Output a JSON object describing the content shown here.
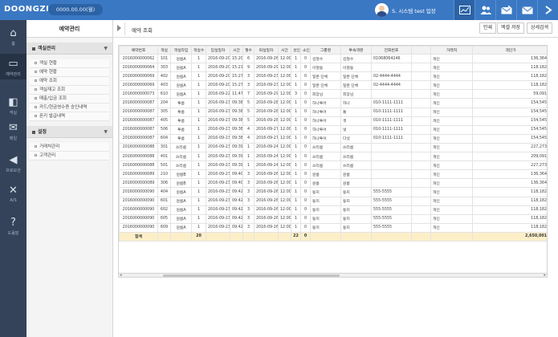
{
  "topbar": {
    "logo": "DOONGZI",
    "balance": "0000.00.00(월)",
    "user_name": "S. 시스템 test 입장",
    "icons": [
      "chart-icon",
      "users-icon",
      "envelope-tools-icon",
      "mail-icon",
      "forward-icon"
    ],
    "accent": "#3a78c3"
  },
  "leftnav": {
    "items": [
      {
        "label": "홈",
        "icon": "home-icon"
      },
      {
        "label": "예약관리",
        "icon": "monitor-icon"
      },
      {
        "label": "객실",
        "icon": "bed-icon"
      },
      {
        "label": "메일",
        "icon": "mail-icon"
      },
      {
        "label": "프로모션",
        "icon": "speaker-icon"
      },
      {
        "label": "A/S",
        "icon": "tools-icon"
      },
      {
        "label": "도움말",
        "icon": "help-icon"
      }
    ]
  },
  "sidemenu": {
    "title": "예약관리",
    "section1": {
      "title": "객실관리",
      "items": [
        "객실 현황",
        "예약 현황",
        "예약 조회",
        "객실재고 조회",
        "매출/입금 조회",
        "카드/현금영수증 승인내역",
        "폰키 발급내역"
      ]
    },
    "section2": {
      "title": "설정",
      "items": [
        "거래처관리",
        "고객관리"
      ]
    }
  },
  "content": {
    "page_title": "예약 조회",
    "buttons": {
      "print": "인쇄",
      "excel": "엑셀 저장",
      "detail_search": "상세검색"
    }
  },
  "grid": {
    "headers": [
      "예약번호",
      "객실",
      "객실타입",
      "객실수",
      "입실일자",
      "시간",
      "월수",
      "퇴실일자",
      "시간",
      "성인",
      "소인",
      "그룹명",
      "투숙객명",
      "전화번호",
      "",
      "거래처",
      "객단가"
    ],
    "rows": [
      [
        "2016000000062",
        "101",
        "원룸A",
        "1",
        "2016-09-20",
        "15:20",
        "6",
        "2016-09-26",
        "12:00",
        "1",
        "0",
        "김철수",
        "김철수",
        "01068064246",
        "",
        "개인",
        "136,364"
      ],
      [
        "2016000000064",
        "303",
        "원룸A",
        "1",
        "2016-09-20",
        "15:21",
        "9",
        "2016-09-29",
        "12:00",
        "1",
        "0",
        "이철동",
        "이철동",
        "",
        "",
        "개인",
        "118,182"
      ],
      [
        "2016000000069",
        "402",
        "원룸A",
        "1",
        "2016-09-20",
        "15:27",
        "3",
        "2016-09-23",
        "12:00",
        "1",
        "0",
        "일본 단체",
        "일본 단체",
        "02-4444-4444",
        "",
        "개인",
        "118,182"
      ],
      [
        "2016000000069",
        "403",
        "원룸A",
        "1",
        "2016-09-20",
        "15:27",
        "3",
        "2016-09-23",
        "12:00",
        "1",
        "0",
        "일본 단체",
        "일본 단체",
        "02-4444-4444",
        "",
        "개인",
        "118,182"
      ],
      [
        "2016000000073",
        "610",
        "원룸A",
        "1",
        "2016-09-22",
        "11:47",
        "7",
        "2016-09-29",
        "12:00",
        "3",
        "0",
        "회장님",
        "회장님",
        "",
        "",
        "개인",
        "59,091"
      ],
      [
        "2016000000087",
        "204",
        "투룸",
        "1",
        "2016-09-23",
        "09:38",
        "5",
        "2016-09-28",
        "12:00",
        "1",
        "0",
        "하나투어",
        "하나",
        "010-1111-1111",
        "",
        "개인",
        "154,545"
      ],
      [
        "2016000000087",
        "305",
        "투룸",
        "1",
        "2016-09-23",
        "09:38",
        "5",
        "2016-09-28",
        "12:00",
        "1",
        "0",
        "하나투어",
        "둘",
        "010-1111-1111",
        "",
        "개인",
        "154,545"
      ],
      [
        "2016000000087",
        "405",
        "투룸",
        "1",
        "2016-09-23",
        "09:38",
        "5",
        "2016-09-28",
        "12:00",
        "1",
        "0",
        "하나투어",
        "셋",
        "010-1111-1111",
        "",
        "개인",
        "154,545"
      ],
      [
        "2016000000087",
        "506",
        "투룸",
        "1",
        "2016-09-23",
        "09:38",
        "4",
        "2016-09-27",
        "12:00",
        "1",
        "0",
        "하나투어",
        "넷",
        "010-1111-1111",
        "",
        "개인",
        "154,545"
      ],
      [
        "2016000000087",
        "604",
        "투룸",
        "1",
        "2016-09-23",
        "09:38",
        "4",
        "2016-09-27",
        "12:00",
        "1",
        "0",
        "하나투어",
        "다섯",
        "010-1111-1111",
        "",
        "개인",
        "154,545"
      ],
      [
        "2016000000088",
        "301",
        "쓰리룸",
        "1",
        "2016-09-23",
        "09:39",
        "1",
        "2016-09-24",
        "12:00",
        "1",
        "0",
        "쓰리룸",
        "쓰리룸",
        "",
        "",
        "개인",
        "227,273"
      ],
      [
        "2016000000088",
        "401",
        "쓰리룸",
        "1",
        "2016-09-23",
        "09:39",
        "1",
        "2016-09-24",
        "12:00",
        "1",
        "0",
        "쓰리룸",
        "쓰리룸",
        "",
        "",
        "개인",
        "209,091"
      ],
      [
        "2016000000088",
        "501",
        "쓰리룸",
        "1",
        "2016-09-23",
        "09:39",
        "1",
        "2016-09-24",
        "12:00",
        "1",
        "0",
        "쓰리룸",
        "쓰리룸",
        "",
        "",
        "개인",
        "227,273"
      ],
      [
        "2016000000089",
        "210",
        "원룸B",
        "1",
        "2016-09-23",
        "09:40",
        "3",
        "2016-09-26",
        "12:00",
        "1",
        "0",
        "원룸",
        "원룸",
        "",
        "",
        "개인",
        "136,364"
      ],
      [
        "2016000000089",
        "306",
        "원룸B",
        "1",
        "2016-09-23",
        "09:40",
        "3",
        "2016-09-26",
        "12:00",
        "1",
        "0",
        "원룸",
        "원룸",
        "",
        "",
        "개인",
        "136,364"
      ],
      [
        "2016000000090",
        "404",
        "원룸A",
        "1",
        "2016-09-23",
        "09:42",
        "3",
        "2016-09-26",
        "12:00",
        "1",
        "0",
        "동지",
        "동지",
        "555-5555",
        "",
        "개인",
        "118,182"
      ],
      [
        "2016000000090",
        "601",
        "원룸A",
        "1",
        "2016-09-23",
        "09:42",
        "3",
        "2016-09-26",
        "12:00",
        "1",
        "0",
        "동지",
        "동지",
        "555-5555",
        "",
        "개인",
        "118,182"
      ],
      [
        "2016000000090",
        "602",
        "원룸A",
        "1",
        "2016-09-23",
        "09:42",
        "3",
        "2016-09-26",
        "12:00",
        "1",
        "0",
        "동지",
        "동지",
        "555-5555",
        "",
        "개인",
        "118,182"
      ],
      [
        "2016000000090",
        "605",
        "원룸A",
        "1",
        "2016-09-23",
        "09:42",
        "3",
        "2016-09-26",
        "12:00",
        "1",
        "0",
        "동지",
        "동지",
        "555-5555",
        "",
        "개인",
        "118,182"
      ],
      [
        "2016000000090",
        "609",
        "원룸A",
        "1",
        "2016-09-23",
        "09:42",
        "3",
        "2016-09-26",
        "12:00",
        "1",
        "0",
        "동지",
        "동지",
        "555-5555",
        "",
        "개인",
        "118,182"
      ]
    ],
    "total": {
      "label": "합계",
      "rooms": "20",
      "adults": "22",
      "children": "0",
      "amount": "2,650,001"
    }
  }
}
